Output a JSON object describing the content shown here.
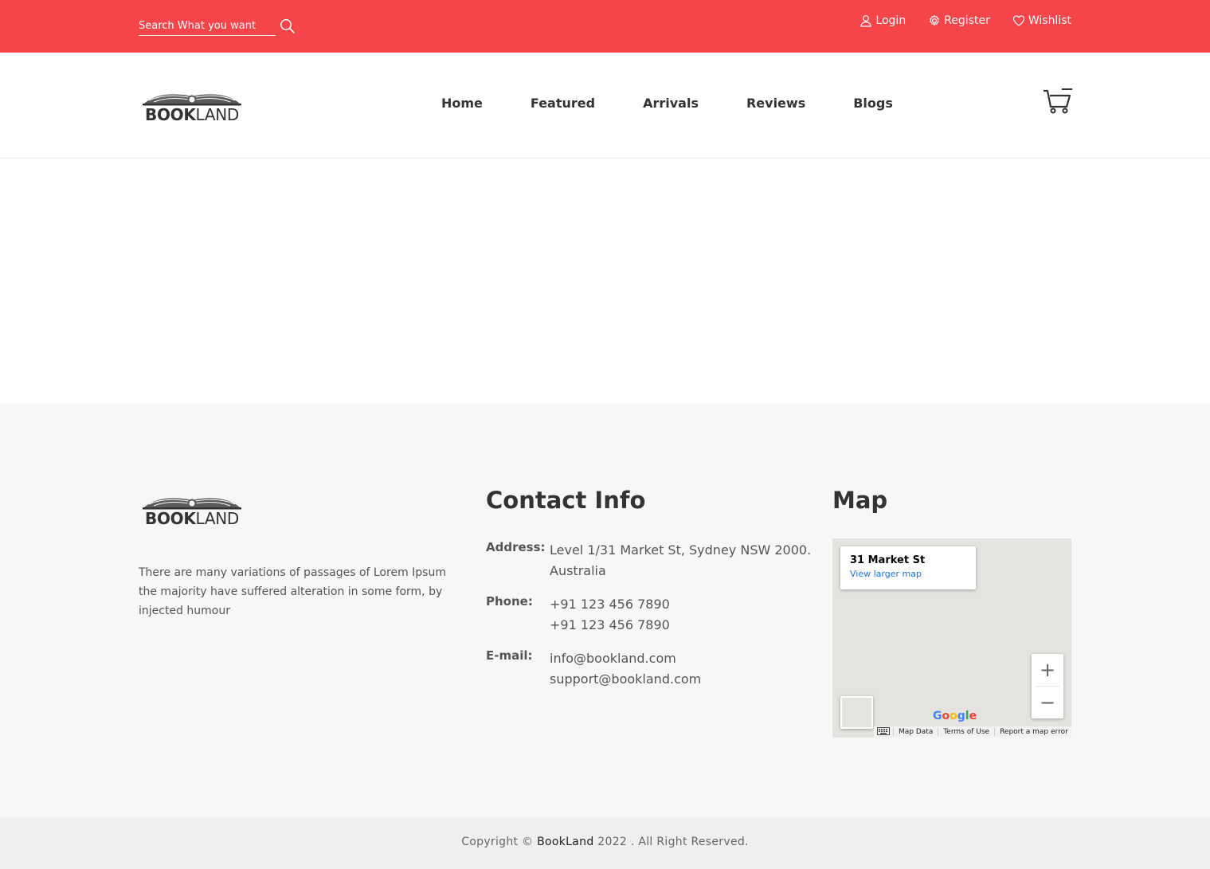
{
  "topbar": {
    "search_placeholder": "Search What you want",
    "links": [
      {
        "label": "Login",
        "icon": "user-icon"
      },
      {
        "label": "Register",
        "icon": "gear-icon"
      },
      {
        "label": "Wishlist",
        "icon": "heart-icon"
      }
    ],
    "bg_color": "#f5444a"
  },
  "logo": {
    "bold": "BOOK",
    "thin": "LAND"
  },
  "nav": {
    "items": [
      "Home",
      "Featured",
      "Arrivals",
      "Reviews",
      "Blogs"
    ]
  },
  "footer": {
    "description": "There are many variations of passages of Lorem Ipsum the majority have suffered alteration in some form, by injected humour",
    "contact_title": "Contact Info",
    "contact": {
      "address_label": "Address:",
      "address_lines": [
        "Level 1/31 Market St, Sydney NSW 2000.",
        "Australia"
      ],
      "phone_label": "Phone:",
      "phones": [
        "+91 123 456 7890",
        "+91 123 456 7890"
      ],
      "email_label": "E-mail:",
      "emails": [
        "info@bookland.com",
        "support@bookland.com"
      ]
    },
    "map_title": "Map",
    "map": {
      "place": "31 Market St",
      "larger_link": "View larger map",
      "zoom_in": "+",
      "zoom_out": "−",
      "google_letters": [
        "G",
        "o",
        "o",
        "g",
        "l",
        "e"
      ],
      "map_data": "Map Data",
      "terms": "Terms of Use",
      "report": "Report a map error"
    }
  },
  "copyright": {
    "prefix": "Copyright ©",
    "brand": "BookLand",
    "suffix": "2022 . All Right Reserved."
  }
}
